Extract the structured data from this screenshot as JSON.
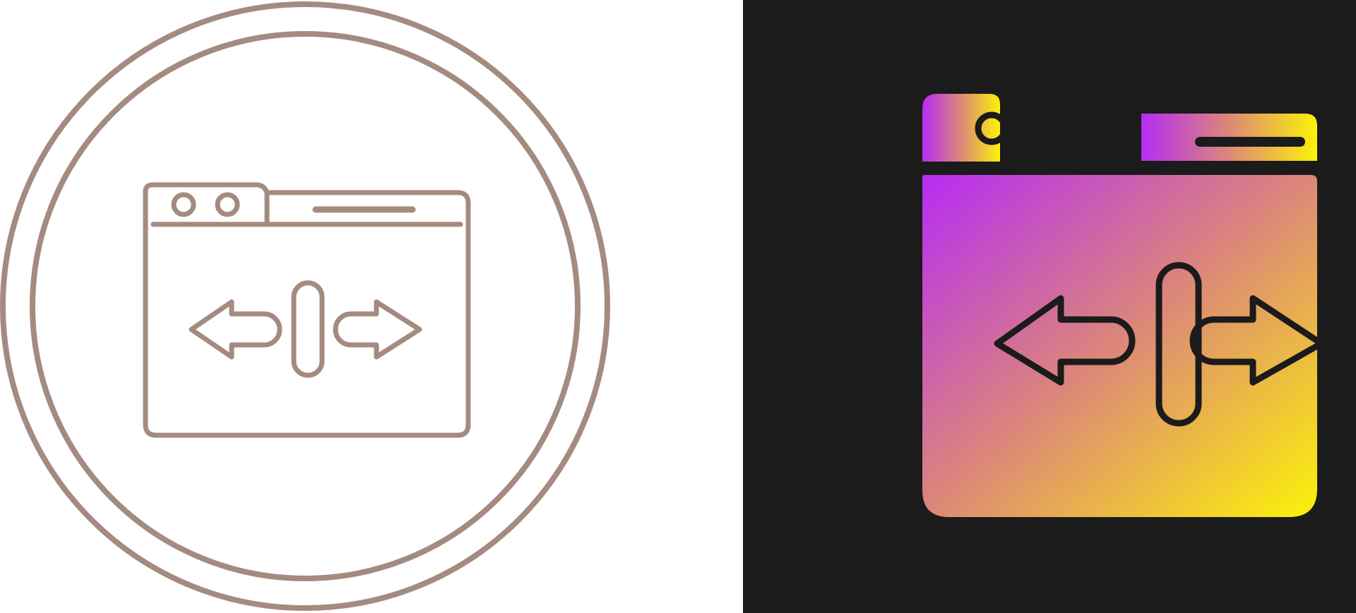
{
  "icons": {
    "outline_variant": {
      "icon": "browser-resize-horizontal-icon",
      "style": "outline-in-circle"
    },
    "gradient_variant": {
      "icon": "browser-resize-horizontal-icon",
      "style": "gradient-fill"
    }
  },
  "colors": {
    "light_background": "#ffffff",
    "dark_background": "#1b1b1b",
    "outline_stroke": "#a48b80",
    "gradient_stroke": "#1b1b1b",
    "gradient_start": "#b62cf4",
    "gradient_mid": "#dc8878",
    "gradient_end": "#fcf208"
  }
}
